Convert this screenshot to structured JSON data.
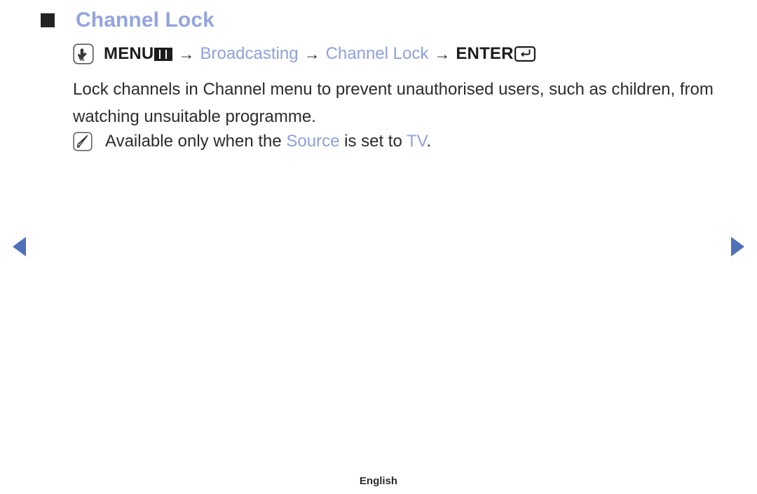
{
  "page": {
    "title": "Channel Lock",
    "title_color": "#93a4de",
    "bullet_icon": "black-square-bullet"
  },
  "menu_path": {
    "hand_icon": "hand-press-button-icon",
    "segments": [
      {
        "text": "MENU",
        "style": "strong"
      },
      {
        "text": "menu-grid-icon",
        "style": "icon"
      },
      {
        "text": "→",
        "style": "arrow"
      },
      {
        "text": "Broadcasting",
        "style": "blue"
      },
      {
        "text": "→",
        "style": "arrow"
      },
      {
        "text": "Channel Lock",
        "style": "blue"
      },
      {
        "text": "→",
        "style": "arrow"
      },
      {
        "text": "ENTER",
        "style": "strong"
      },
      {
        "text": "enter-key-icon",
        "style": "icon"
      }
    ],
    "menu_label": "MENU",
    "enter_label": "ENTER",
    "arrow": "→",
    "broadcasting_label": "Broadcasting",
    "channel_lock_label": "Channel Lock"
  },
  "body": {
    "paragraph": "Lock channels in Channel menu to prevent unauthorised users, such as children, from watching unsuitable programme."
  },
  "note": {
    "icon": "note-pencil-icon",
    "prefix": "Available only when the ",
    "highlight_1": "Source",
    "middle": " is set to ",
    "highlight_2": "TV",
    "suffix": ".",
    "highlight_color": "#8fa1dc"
  },
  "navigation": {
    "prev_label": "previous-page-arrow",
    "next_label": "next-page-arrow",
    "arrow_color": "#4f71b8"
  },
  "footer": {
    "language": "English"
  }
}
